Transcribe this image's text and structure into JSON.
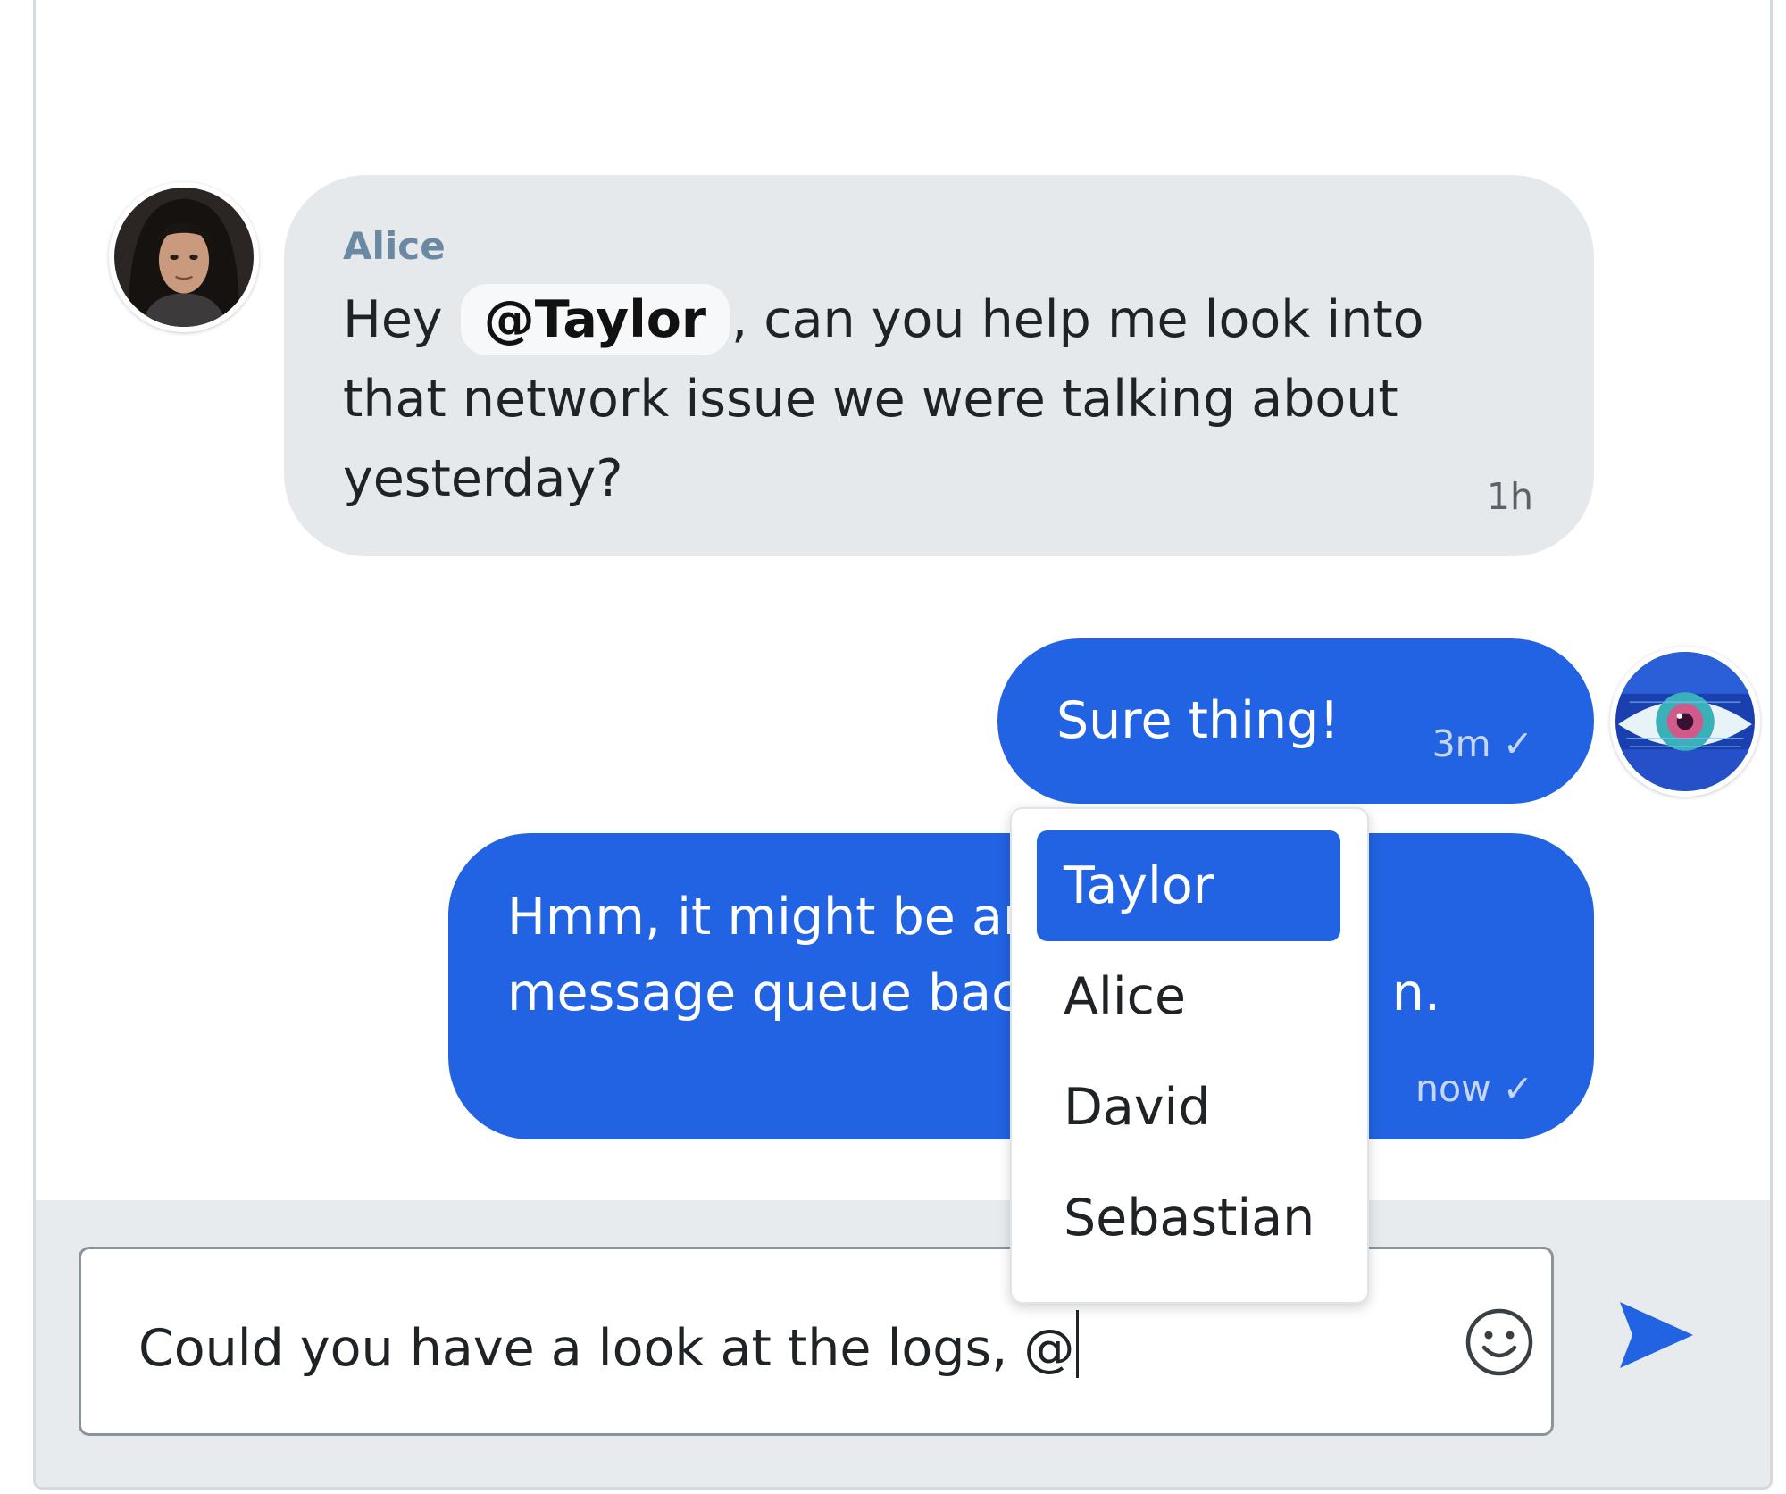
{
  "messages": {
    "incoming": {
      "sender": "Alice",
      "text_before": "Hey",
      "mention": "@Taylor",
      "text_after": ",  can you help me look into that network issue we were talking about yesterday?",
      "timestamp": "1h",
      "avatar": "alice-avatar"
    },
    "outgoing": [
      {
        "text_lines": [
          "Sure thing!"
        ],
        "timestamp": "3m ✓"
      },
      {
        "text_lines": [
          "Hmm, it might be an",
          "message queue back"
        ],
        "tail_text": "n.",
        "timestamp": "now ✓"
      }
    ],
    "my_avatar": "eye-avatar"
  },
  "composer": {
    "value": "Could you have a look at the logs, @",
    "emoji_icon": "smiley-icon",
    "send_icon": "send-arrow-icon"
  },
  "mention_dropdown": {
    "options": [
      "Taylor",
      "Alice",
      "David",
      "Sebastian"
    ],
    "selected": "Taylor"
  },
  "colors": {
    "accent": "#2163e3",
    "incoming_bubble": "#e5e9ec",
    "sender_name": "#6b89a3",
    "composer_bg": "#e7ebee"
  }
}
